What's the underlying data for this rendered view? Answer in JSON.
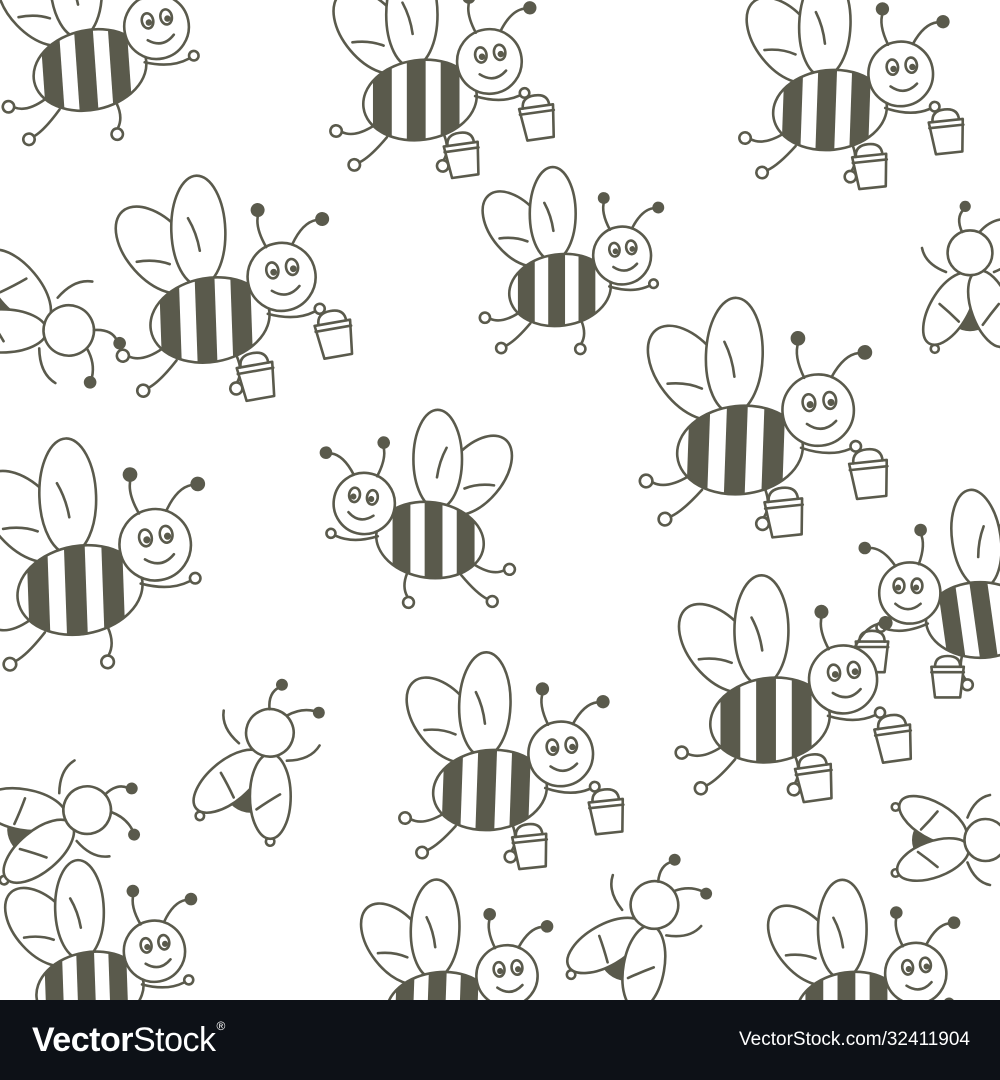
{
  "colors": {
    "line": "#5a5a4c",
    "stripe": "#5a5a4c",
    "background": "#ffffff",
    "footer": "#0d1117",
    "footer_text": "#ffffff"
  },
  "footer": {
    "brand": {
      "bold": "Vector",
      "light": "Stock",
      "mark": "®"
    },
    "credit": "VectorStock.com/32411904"
  }
}
